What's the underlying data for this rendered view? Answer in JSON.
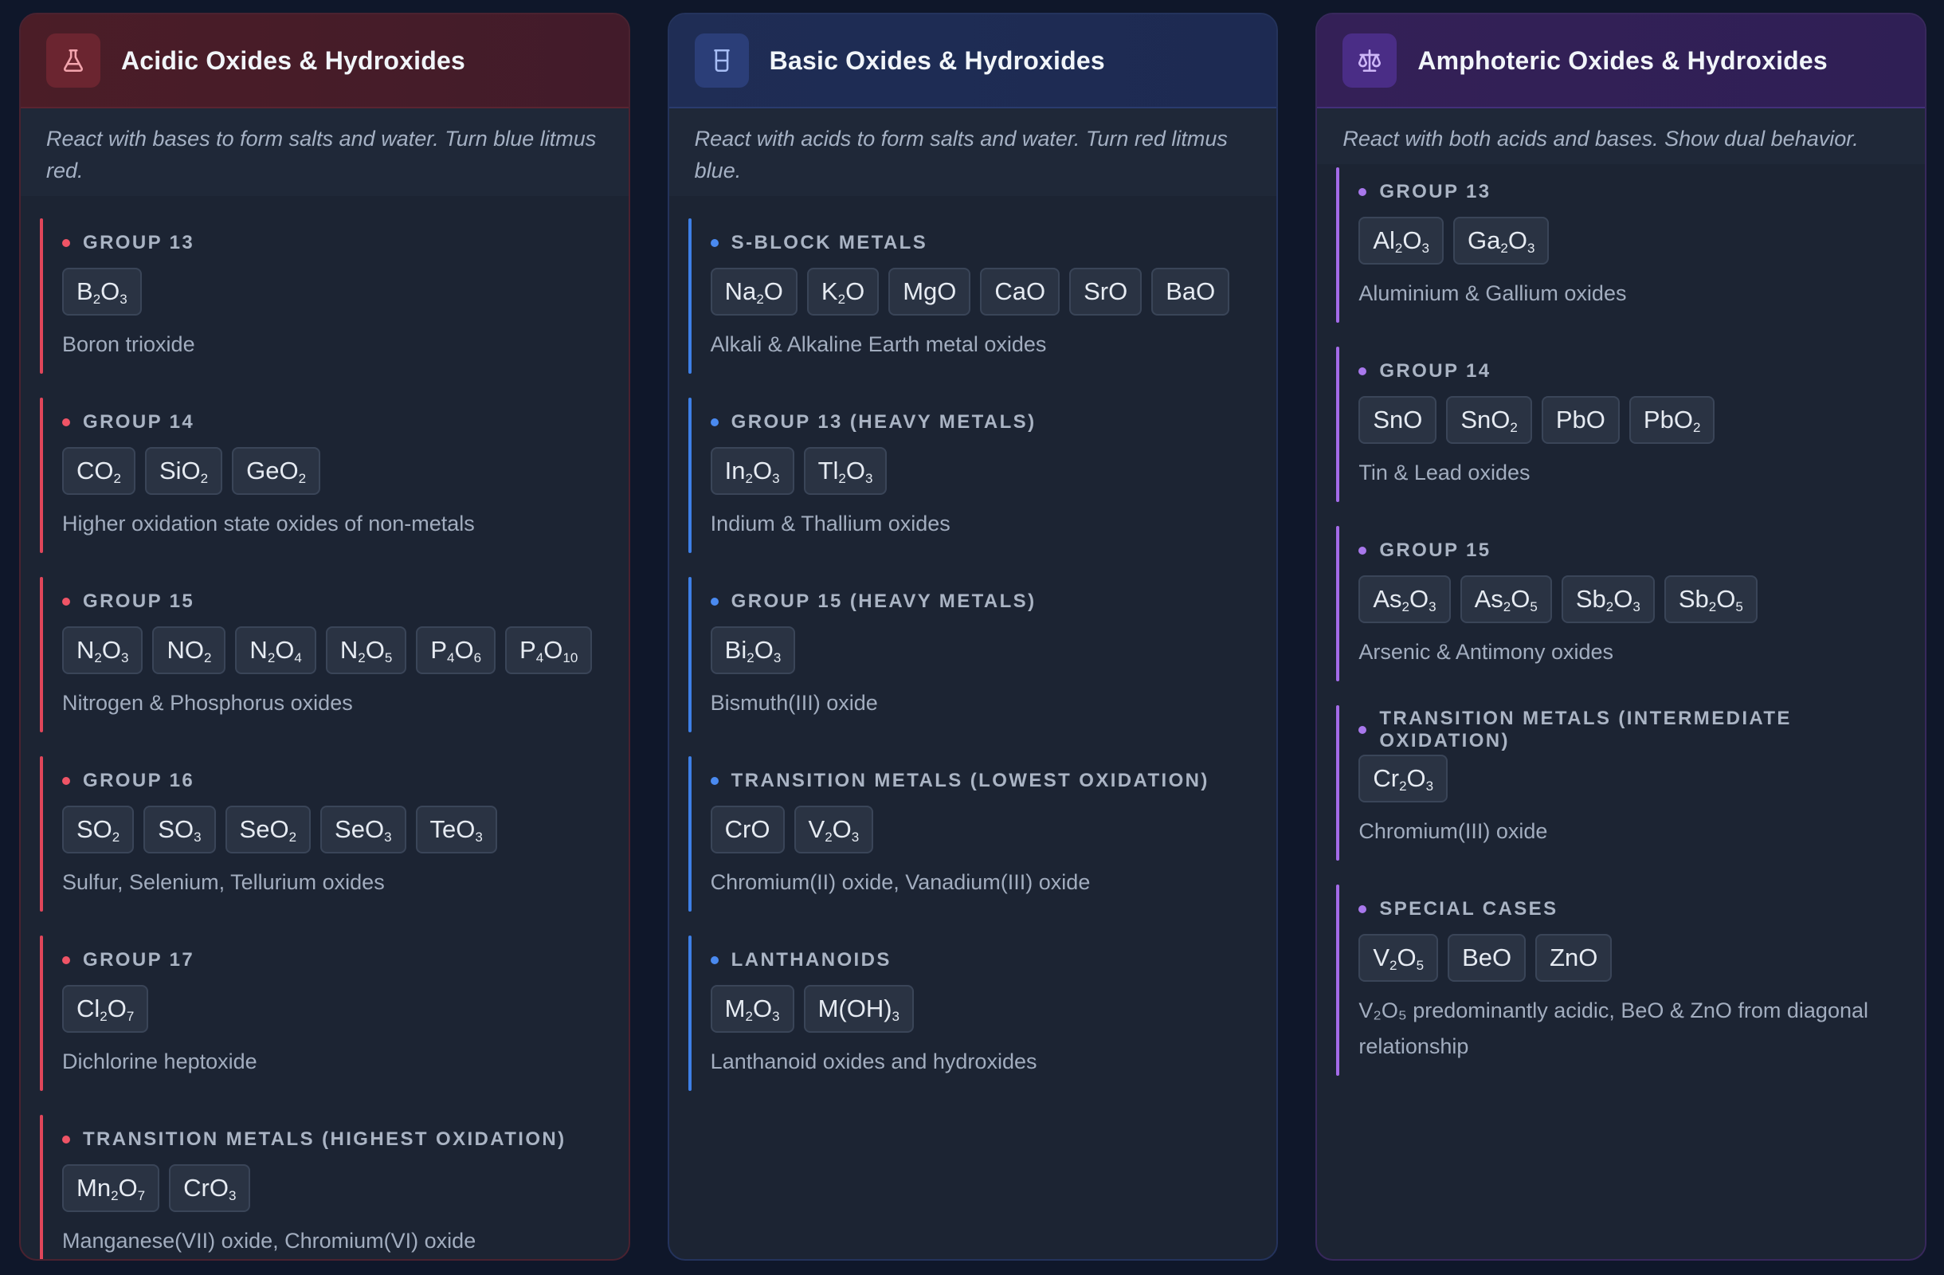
{
  "panels": [
    {
      "key": "acidic",
      "icon": "flask-icon",
      "title": "Acidic Oxides & Hydroxides",
      "description": "React with bases to form salts and water. Turn blue litmus red.",
      "accent": "#e0465a",
      "groups": [
        {
          "title": "Group 13",
          "chips": [
            [
              [
                "B",
                ""
              ],
              [
                "O",
                "3"
              ]
            ]
          ],
          "chips_sub_fix": true,
          "note": "Boron trioxide"
        },
        {
          "title": "Group 14",
          "chips": [],
          "note": "Higher oxidation state oxides of non-metals"
        },
        {
          "title": "Group 15",
          "chips": [],
          "note": "Nitrogen & Phosphorus oxides"
        },
        {
          "title": "Group 16",
          "chips": [],
          "note": "Sulfur, Selenium, Tellurium oxides"
        },
        {
          "title": "Group 17",
          "chips": [],
          "note": "Dichlorine heptoxide"
        },
        {
          "title": "Transition Metals (Highest Oxidation)",
          "chips": [],
          "note": "Manganese(VII) oxide, Chromium(VI) oxide"
        }
      ]
    },
    {
      "key": "basic",
      "icon": "beaker-icon",
      "title": "Basic Oxides & Hydroxides",
      "description": "React with acids to form salts and water. Turn red litmus blue.",
      "accent": "#3d7fe6",
      "groups": [
        {
          "title": "S-Block Metals",
          "chips": [],
          "note": "Alkali & Alkaline Earth metal oxides"
        },
        {
          "title": "Group 13 (Heavy Metals)",
          "chips": [],
          "note": "Indium & Thallium oxides"
        },
        {
          "title": "Group 15 (Heavy Metals)",
          "chips": [],
          "note": "Bismuth(III) oxide"
        },
        {
          "title": "Transition Metals (Lowest Oxidation)",
          "chips": [],
          "note": "Chromium(II) oxide, Vanadium(III) oxide"
        },
        {
          "title": "Lanthanoids",
          "chips": [],
          "note": "Lanthanoid oxides and hydroxides"
        }
      ]
    },
    {
      "key": "amph",
      "icon": "scale-balance-icon",
      "title": "Amphoteric Oxides & Hydroxides",
      "description": "React with both acids and bases. Show dual behavior.",
      "accent": "#a36be8",
      "groups": [
        {
          "title": "Group 13",
          "chips": [],
          "note": "Aluminium & Gallium oxides"
        },
        {
          "title": "Group 14",
          "chips": [],
          "note": "Tin & Lead oxides"
        },
        {
          "title": "Group 15",
          "chips": [],
          "note": "Arsenic & Antimony oxides"
        },
        {
          "title": "Transition Metals (Intermediate Oxidation)",
          "chips": [],
          "note": "Chromium(III) oxide"
        },
        {
          "title": "Special Cases",
          "chips": [],
          "note": "V₂O₅ predominantly acidic, BeO & ZnO from diagonal relationship"
        }
      ]
    }
  ],
  "formulas": {
    "acidic": [
      [
        [
          "B",
          "2",
          "O",
          "3"
        ]
      ],
      [
        [
          "CO",
          "2"
        ],
        [
          "SiO",
          "2"
        ],
        [
          "GeO",
          "2"
        ]
      ],
      [
        [
          "N",
          "2",
          "O",
          "3"
        ],
        [
          "NO",
          "2"
        ],
        [
          "N",
          "2",
          "O",
          "4"
        ],
        [
          "N",
          "2",
          "O",
          "5"
        ],
        [
          "P",
          "4",
          "O",
          "6"
        ],
        [
          "P",
          "4",
          "O",
          "10"
        ]
      ],
      [
        [
          "SO",
          "2"
        ],
        [
          "SO",
          "3"
        ],
        [
          "SeO",
          "2"
        ],
        [
          "SeO",
          "3"
        ],
        [
          "TeO",
          "3"
        ]
      ],
      [
        [
          "Cl",
          "2",
          "O",
          "7"
        ]
      ],
      [
        [
          "Mn",
          "2",
          "O",
          "7"
        ],
        [
          "CrO",
          "3"
        ]
      ]
    ],
    "basic": [
      [
        [
          "Na",
          "2",
          "O"
        ],
        [
          "K",
          "2",
          "O"
        ],
        [
          "MgO"
        ],
        [
          "CaO"
        ],
        [
          "SrO"
        ],
        [
          "BaO"
        ]
      ],
      [
        [
          "In",
          "2",
          "O",
          "3"
        ],
        [
          "Tl",
          "2",
          "O",
          "3"
        ]
      ],
      [
        [
          "Bi",
          "2",
          "O",
          "3"
        ]
      ],
      [
        [
          "CrO"
        ],
        [
          "V",
          "2",
          "O",
          "3"
        ]
      ],
      [
        [
          "M",
          "2",
          "O",
          "3"
        ],
        [
          "M(OH)",
          "3"
        ]
      ]
    ],
    "amph": [
      [
        [
          "Al",
          "2",
          "O",
          "3"
        ],
        [
          "Ga",
          "2",
          "O",
          "3"
        ]
      ],
      [
        [
          "SnO"
        ],
        [
          "SnO",
          "2"
        ],
        [
          "PbO"
        ],
        [
          "PbO",
          "2"
        ]
      ],
      [
        [
          "As",
          "2",
          "O",
          "3"
        ],
        [
          "As",
          "2",
          "O",
          "5"
        ],
        [
          "Sb",
          "2",
          "O",
          "3"
        ],
        [
          "Sb",
          "2",
          "O",
          "5"
        ]
      ],
      [
        [
          "Cr",
          "2",
          "O",
          "3"
        ]
      ],
      [
        [
          "V",
          "2",
          "O",
          "5"
        ],
        [
          "BeO"
        ],
        [
          "ZnO"
        ]
      ]
    ]
  }
}
